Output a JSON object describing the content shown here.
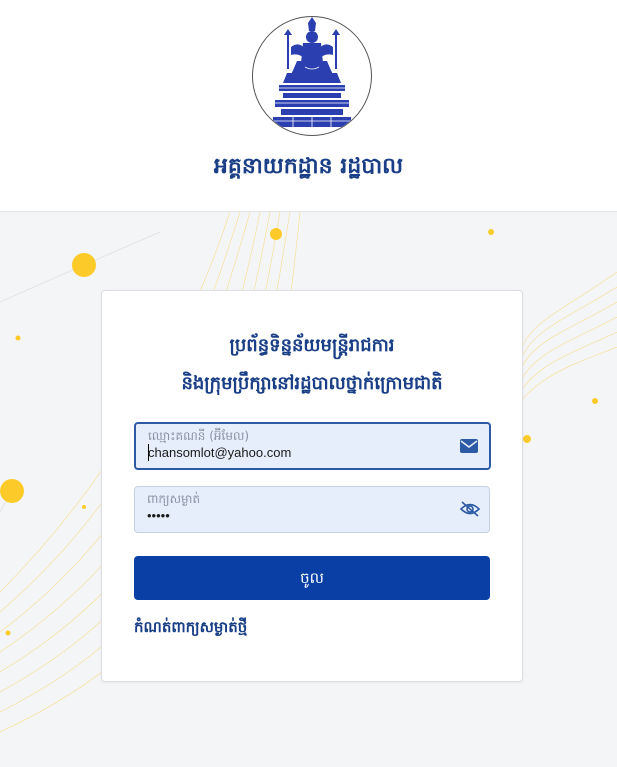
{
  "header": {
    "org_title": "អគ្គនាយកដ្ឋាន រដ្ឋបាល"
  },
  "login": {
    "title_line1": "ប្រព័ន្ធទិន្នន័យមន្ត្រីរាជការ",
    "title_line2": "និងក្រុមប្រឹក្សានៅរដ្ឋបាលថ្នាក់ក្រោមជាតិ",
    "username": {
      "label": "ឈ្មោះគណនី (អ៊ីមែល)",
      "value": "chansomlot@yahoo.com",
      "icon": "envelope-icon"
    },
    "password": {
      "label": "ពាក្យសម្ងាត់",
      "value": "•••••",
      "icon": "eye-off-icon"
    },
    "submit_label": "ចូល",
    "reset_link": "កំណត់ពាក្យសម្ងាត់ថ្មី"
  },
  "colors": {
    "brand_blue": "#0a3fa6",
    "title_blue": "#1a3f86",
    "accent_yellow": "#fccb2a",
    "field_bg": "#e7eefb"
  }
}
